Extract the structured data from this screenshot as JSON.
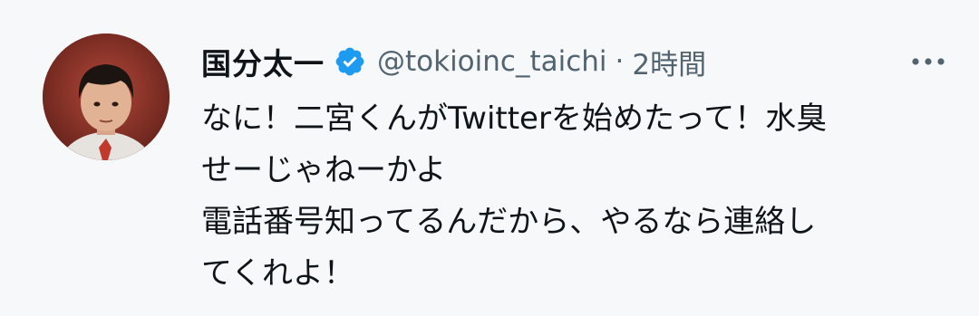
{
  "tweet": {
    "display_name": "国分太一",
    "handle": "@tokioinc_taichi",
    "separator": "·",
    "timestamp": "2時間",
    "body": "なに！二宮くんがTwitterを始めたって！水臭\nせーじゃねーかよ\n電話番号知ってるんだから、やるなら連絡し\nてくれよ！"
  },
  "icons": {
    "verified": "verified-badge-icon",
    "more": "more-options-icon"
  },
  "colors": {
    "background": "#f6f8fa",
    "primary_text": "#0f1419",
    "secondary_text": "#536471",
    "verified_blue": "#1d9bf0"
  }
}
